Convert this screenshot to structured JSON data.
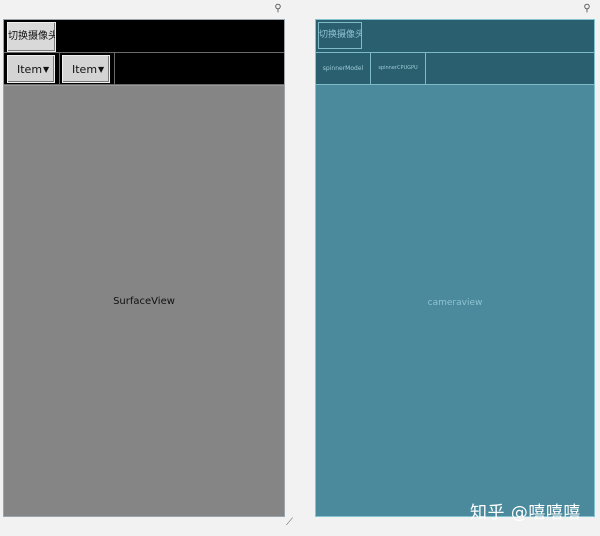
{
  "design": {
    "switch_button": "切换摄像头",
    "spinner_model": "Item",
    "spinner_gpu": "Item",
    "spinner_arrow": "▼",
    "surface_label": "SurfaceView"
  },
  "blueprint": {
    "switch_button": "切换摄像头",
    "spinner_model": "spinnerModel",
    "spinner_gpu": "spinnerCPUGPU",
    "camera_label": "cameraview"
  },
  "watermark": "知乎 @嘻嘻嘻",
  "icons": {
    "pin": "pin-icon",
    "resize": "resize-handle-icon"
  },
  "colors": {
    "design_bg": "#000000",
    "surface": "#858585",
    "blueprint_bg": "#4a8a9c",
    "blueprint_bar": "#2a5f70",
    "blueprint_line": "#7fbac7"
  }
}
